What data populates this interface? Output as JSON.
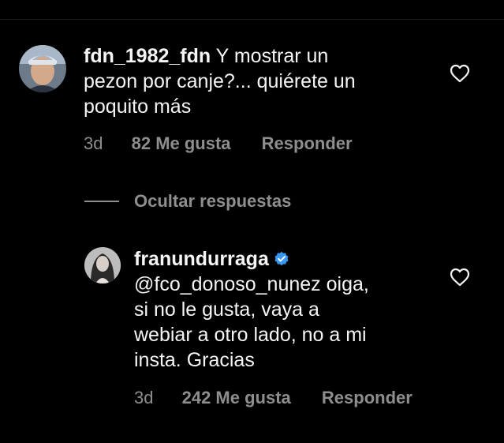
{
  "comments": [
    {
      "username": "fdn_1982_fdn",
      "text_line1": " Y mostrar un",
      "text_line2": "pezon por canje?... quiérete un",
      "text_line3": "poquito más",
      "time": "3d",
      "likes": "82 Me gusta",
      "reply_label": "Responder",
      "verified": false
    }
  ],
  "hide_replies_label": "Ocultar respuestas",
  "replies": [
    {
      "username": "franundurraga",
      "verified": true,
      "text_line1": "@fco_donoso_nunez oiga,",
      "text_line2": "si no le gusta, vaya a",
      "text_line3": "webiar a otro lado, no a mi",
      "text_line4": "insta. Gracias",
      "time": "3d",
      "likes": "242 Me gusta",
      "reply_label": "Responder"
    }
  ],
  "colors": {
    "background": "#000000",
    "text": "#f5f5f5",
    "secondary": "#8e8e8e",
    "verified_blue": "#3897f0"
  },
  "icons": {
    "like": "heart-outline-icon",
    "verified": "verified-badge-icon"
  }
}
